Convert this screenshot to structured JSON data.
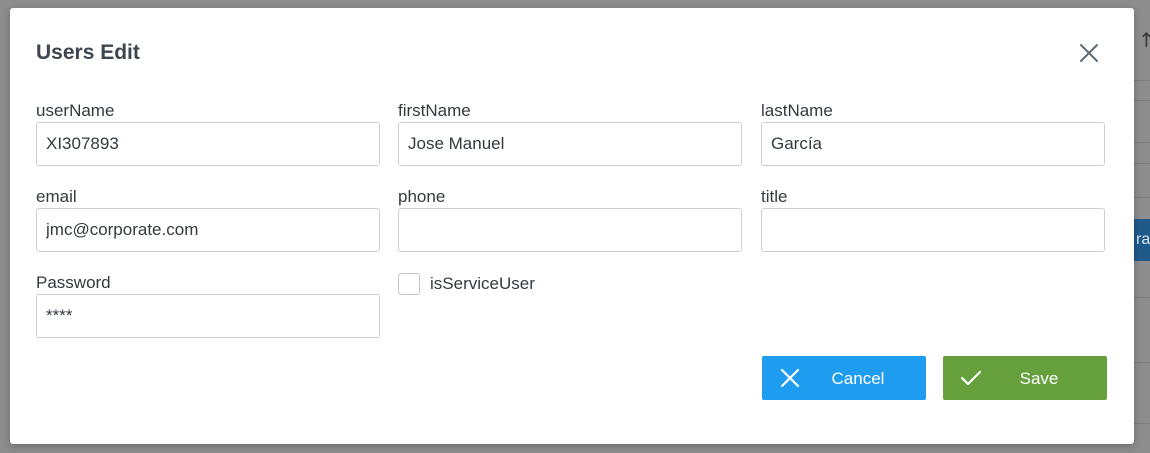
{
  "modal": {
    "title": "Users Edit"
  },
  "fields": {
    "userName": {
      "label": "userName",
      "value": "XI307893"
    },
    "firstName": {
      "label": "firstName",
      "value": "Jose Manuel"
    },
    "lastName": {
      "label": "lastName",
      "value": "García"
    },
    "email": {
      "label": "email",
      "value": "jmc@corporate.com"
    },
    "phone": {
      "label": "phone",
      "value": ""
    },
    "title": {
      "label": "title",
      "value": ""
    },
    "password": {
      "label": "Password",
      "value": "****"
    }
  },
  "checkbox": {
    "label": "isServiceUser",
    "checked": false
  },
  "buttons": {
    "cancel_label": "Cancel",
    "save_label": "Save"
  },
  "background": {
    "arrow_glyph": "↑",
    "button_fragment": "ra"
  },
  "colors": {
    "cancel": "#1e9cf0",
    "save": "#66a03c",
    "title_text": "#3d4650"
  },
  "icons": {
    "close": "close-icon",
    "cancel": "x-icon",
    "save": "checkmark-icon"
  }
}
